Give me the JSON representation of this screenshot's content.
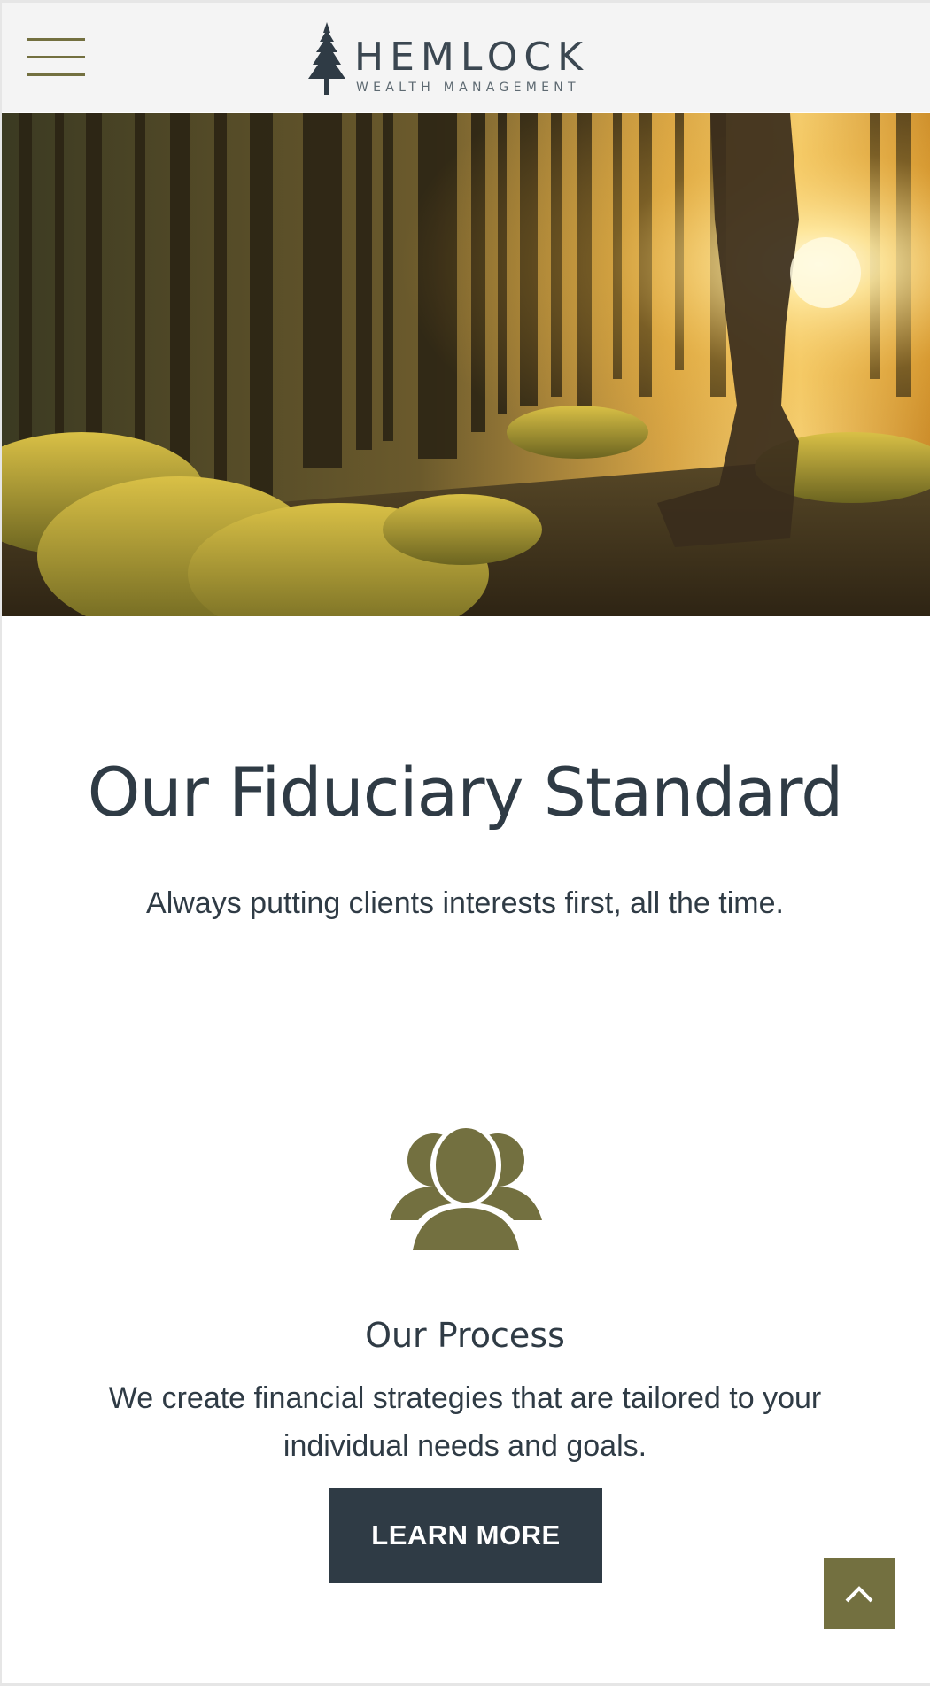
{
  "header": {
    "menu_icon": "hamburger-menu-icon",
    "logo": {
      "icon": "pine-tree-icon",
      "title": "HEMLOCK",
      "subtitle": "WEALTH MANAGEMENT"
    }
  },
  "hero": {
    "image": "sunlit-forest-walker-photo"
  },
  "intro": {
    "heading": "Our Fiduciary Standard",
    "tagline": "Always putting clients interests first, all the time."
  },
  "process": {
    "icon": "group-people-icon",
    "title": "Our Process",
    "text": "We create financial strategies that are tailored to your individual needs and goals.",
    "button_label": "LEARN MORE"
  },
  "scroll_top": {
    "icon": "chevron-up-icon"
  },
  "colors": {
    "brand_olive": "#737040",
    "text_dark": "#2f3b45",
    "header_bg": "#f4f4f4"
  }
}
